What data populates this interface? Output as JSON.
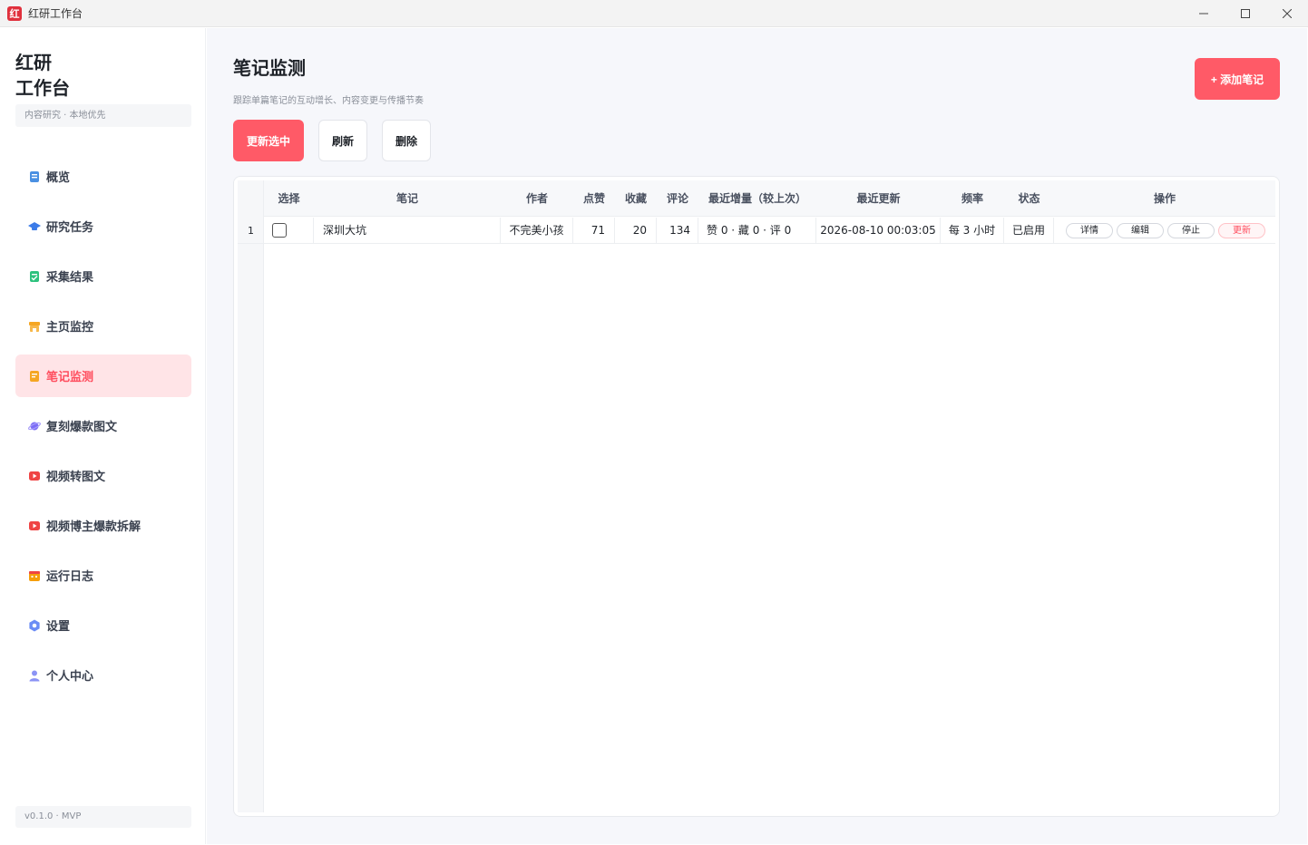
{
  "window": {
    "title": "红研工作台",
    "icon_text": "红"
  },
  "sidebar": {
    "brand_line1": "红研",
    "brand_line2": "工作台",
    "subtitle": "内容研究 · 本地优先",
    "items": [
      {
        "label": "概览",
        "icon": "document-icon",
        "color": "#4a90e2"
      },
      {
        "label": "研究任务",
        "icon": "graduation-cap-icon",
        "color": "#3b7be8"
      },
      {
        "label": "采集结果",
        "icon": "checklist-icon",
        "color": "#2ec27e"
      },
      {
        "label": "主页监控",
        "icon": "store-icon",
        "color": "#f5a623"
      },
      {
        "label": "笔记监测",
        "icon": "note-icon",
        "color": "#f5a623",
        "active": true
      },
      {
        "label": "复刻爆款图文",
        "icon": "planet-icon",
        "color": "#7b6cf6"
      },
      {
        "label": "视频转图文",
        "icon": "video-icon",
        "color": "#ef4444"
      },
      {
        "label": "视频博主爆款拆解",
        "icon": "video-icon",
        "color": "#ef4444"
      },
      {
        "label": "运行日志",
        "icon": "calendar-icon",
        "color": "#f59e0b"
      },
      {
        "label": "设置",
        "icon": "settings-icon",
        "color": "#6b8cf5"
      },
      {
        "label": "个人中心",
        "icon": "user-icon",
        "color": "#8b93f5"
      }
    ],
    "version": "v0.1.0 · MVP"
  },
  "main": {
    "title": "笔记监测",
    "subtitle": "跟踪单篇笔记的互动增长、内容变更与传播节奏",
    "add_button": "+ 添加笔记",
    "toolbar": {
      "update_selected": "更新选中",
      "refresh": "刷新",
      "delete": "删除"
    },
    "table": {
      "headers": [
        "选择",
        "笔记",
        "作者",
        "点赞",
        "收藏",
        "评论",
        "最近增量（较上次）",
        "最近更新",
        "频率",
        "状态",
        "操作"
      ],
      "rows": [
        {
          "index": "1",
          "checked": false,
          "note": "深圳大坑",
          "author": "不完美小孩",
          "likes": "71",
          "collects": "20",
          "comments": "134",
          "delta": "赞 0 · 藏 0 · 评 0",
          "updated": "2026-08-10 00:03:05",
          "frequency": "每 3 小时",
          "status": "已启用",
          "actions": {
            "detail": "详情",
            "edit": "编辑",
            "stop": "停止",
            "update": "更新"
          }
        }
      ]
    }
  }
}
